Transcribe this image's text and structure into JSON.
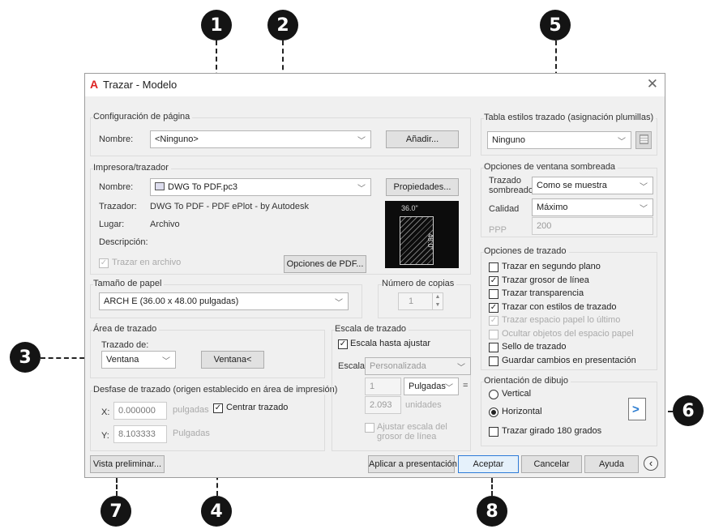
{
  "callouts": [
    "1",
    "2",
    "3",
    "4",
    "5",
    "6",
    "7",
    "8"
  ],
  "dialog": {
    "title": "Trazar - Modelo",
    "logo": "A",
    "close_icon": "✕"
  },
  "page_setup": {
    "group_title": "Configuración de página",
    "name_label": "Nombre:",
    "name_value": "<Ninguno>",
    "add_button": "Añadir..."
  },
  "printer": {
    "group_title": "Impresora/trazador",
    "name_label": "Nombre:",
    "name_value": "DWG To PDF.pc3",
    "properties_button": "Propiedades...",
    "plotter_label": "Trazador:",
    "plotter_value": "DWG To PDF - PDF ePlot - by Autodesk",
    "where_label": "Lugar:",
    "where_value": "Archivo",
    "description_label": "Descripción:",
    "plot_to_file_label": "Trazar en archivo",
    "pdf_options_button": "Opciones de PDF...",
    "preview_width": "36.0\"",
    "preview_height": "48.0\""
  },
  "paper_size": {
    "group_title": "Tamaño de papel",
    "value": "ARCH E (36.00 x 48.00 pulgadas)"
  },
  "copies": {
    "group_title": "Número de copias",
    "value": "1"
  },
  "plot_area": {
    "group_title": "Área de trazado",
    "what_label": "Trazado de:",
    "what_value": "Ventana",
    "window_button": "Ventana<"
  },
  "plot_offset": {
    "group_title": "Desfase de trazado (origen establecido en área de impresión)",
    "x_label": "X:",
    "x_value": "0.000000",
    "x_unit": "pulgadas",
    "y_label": "Y:",
    "y_value": "8.103333",
    "y_unit": "Pulgadas",
    "center_label": "Centrar trazado"
  },
  "plot_scale": {
    "group_title": "Escala de trazado",
    "fit_label": "Escala hasta ajustar",
    "scale_label": "Escala:",
    "scale_value": "Personalizada",
    "value1": "1",
    "unit": "Pulgadas",
    "equals": "=",
    "value2": "2.093",
    "units_label": "unidades",
    "lineweights_label": "Ajustar escala del grosor de línea"
  },
  "style_table": {
    "group_title": "Tabla estilos trazado (asignación plumillas)",
    "value": "Ninguno"
  },
  "shaded": {
    "group_title": "Opciones de ventana sombreada",
    "shade_label": "Trazado sombreado",
    "shade_value": "Como se muestra",
    "quality_label": "Calidad",
    "quality_value": "Máximo",
    "dpi_label": "PPP",
    "dpi_value": "200"
  },
  "plot_options": {
    "group_title": "Opciones de trazado",
    "items": [
      {
        "label": "Trazar en segundo plano",
        "checked": false,
        "disabled": false
      },
      {
        "label": "Trazar grosor de línea",
        "checked": true,
        "disabled": false
      },
      {
        "label": "Trazar transparencia",
        "checked": false,
        "disabled": false
      },
      {
        "label": "Trazar con estilos de trazado",
        "checked": true,
        "disabled": false
      },
      {
        "label": "Trazar espacio papel lo último",
        "checked": true,
        "disabled": true
      },
      {
        "label": "Ocultar objetos del espacio papel",
        "checked": false,
        "disabled": true
      },
      {
        "label": "Sello de trazado",
        "checked": false,
        "disabled": false
      },
      {
        "label": "Guardar cambios en presentación",
        "checked": false,
        "disabled": false
      }
    ]
  },
  "orientation": {
    "group_title": "Orientación de dibujo",
    "portrait": "Vertical",
    "landscape": "Horizontal",
    "upside_down": "Trazar girado 180 grados",
    "selected": "Horizontal"
  },
  "footer": {
    "preview_button": "Vista preliminar...",
    "apply_button": "Aplicar a presentación",
    "ok_button": "Aceptar",
    "cancel_button": "Cancelar",
    "help_button": "Ayuda",
    "expand_icon": "‹"
  }
}
